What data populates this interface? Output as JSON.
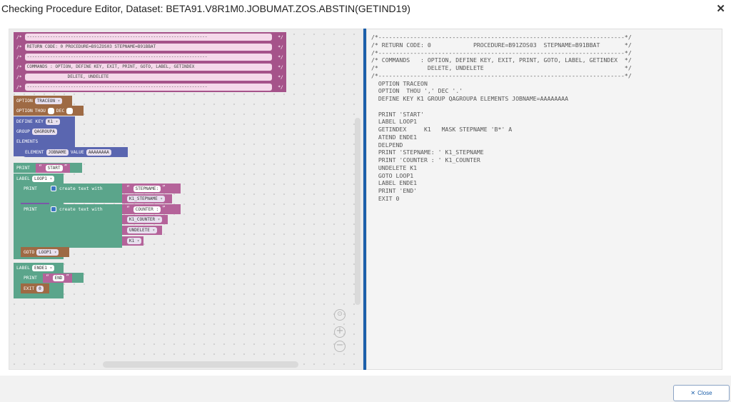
{
  "window": {
    "title": "Checking Procedure Editor, Dataset: BETA91.V8R1M0.JOBUMAT.ZOS.ABSTIN(GETIND19)",
    "close_icon": "close-icon",
    "close_button_label": "Close"
  },
  "blocks": {
    "comments": [
      "----------------------------------------------------------------------",
      "RETURN CODE: 0            PROCEDURE=B91ZOS03  STEPNAME=B91BBAT",
      "----------------------------------------------------------------------",
      "COMMANDS   : OPTION, DEFINE KEY, EXIT, PRINT, GOTO, LABEL, GETINDEX",
      "             DELETE, UNDELETE",
      "----------------------------------------------------------------------"
    ],
    "comment_open": "/*",
    "comment_close": "*/",
    "option1": {
      "kw": "OPTION",
      "val": "TRACEON"
    },
    "option2": {
      "kw": "OPTION",
      "kw2": "THOU",
      "kw3": "DEC",
      "val": ""
    },
    "define": {
      "kw": "DEFINE KEY",
      "key": "K1",
      "group_kw": "GROUP",
      "group": "QAGROUPA",
      "elements_kw": "ELEMENTS",
      "element_kw": "ELEMENT",
      "element": "JOBNAME",
      "value_kw": "VALUE",
      "value": "AAAAAAAA"
    },
    "print_start": {
      "kw": "PRINT",
      "text": "START"
    },
    "label_loop": {
      "kw": "LABEL",
      "val": "LOOP1"
    },
    "print_step": {
      "kw": "PRINT",
      "create": "create text with",
      "lit": "STEPNAME: ",
      "var": "K1_STEPNAME"
    },
    "print_counter": {
      "kw": "PRINT",
      "create": "create text with",
      "lit": "COUNTER : ",
      "var1": "K1_COUNTER",
      "var2": "UNDELETE",
      "var3": "K1"
    },
    "goto": {
      "kw": "GOTO",
      "val": "LOOP1"
    },
    "label_ende": {
      "kw": "LABEL",
      "val": "ENDE1"
    },
    "print_end": {
      "kw": "PRINT",
      "text": "END"
    },
    "exit": {
      "kw": "EXIT",
      "val": "0"
    }
  },
  "code": "/*----------------------------------------------------------------------*/\n/* RETURN CODE: 0            PROCEDURE=B91ZOS03  STEPNAME=B91BBAT       */\n/*----------------------------------------------------------------------*/\n/* COMMANDS   : OPTION, DEFINE KEY, EXIT, PRINT, GOTO, LABEL, GETINDEX  */\n/*              DELETE, UNDELETE                                        */\n/*----------------------------------------------------------------------*/\n  OPTION TRACEON\n  OPTION  THOU ',' DEC '.'\n  DEFINE KEY K1 GROUP QAGROUPA ELEMENTS JOBNAME=AAAAAAAA\n\n  PRINT 'START'\n  LABEL LOOP1\n  GETINDEX     K1   MASK STEPNAME 'B*' A\n  ATEND ENDE1\n  DELPEND\n  PRINT 'STEPNAME: ' K1_STEPNAME\n  PRINT 'COUNTER : ' K1_COUNTER\n  UNDELETE K1\n  GOTO LOOP1\n  LABEL ENDE1\n  PRINT 'END'\n  EXIT 0",
  "colors": {
    "accent": "#1c5faa",
    "comment": "#a5538a",
    "option": "#9e6a44",
    "define": "#5a66b0",
    "print": "#5ba58b",
    "loop": "#7b58a8",
    "text": "#b5639a"
  }
}
